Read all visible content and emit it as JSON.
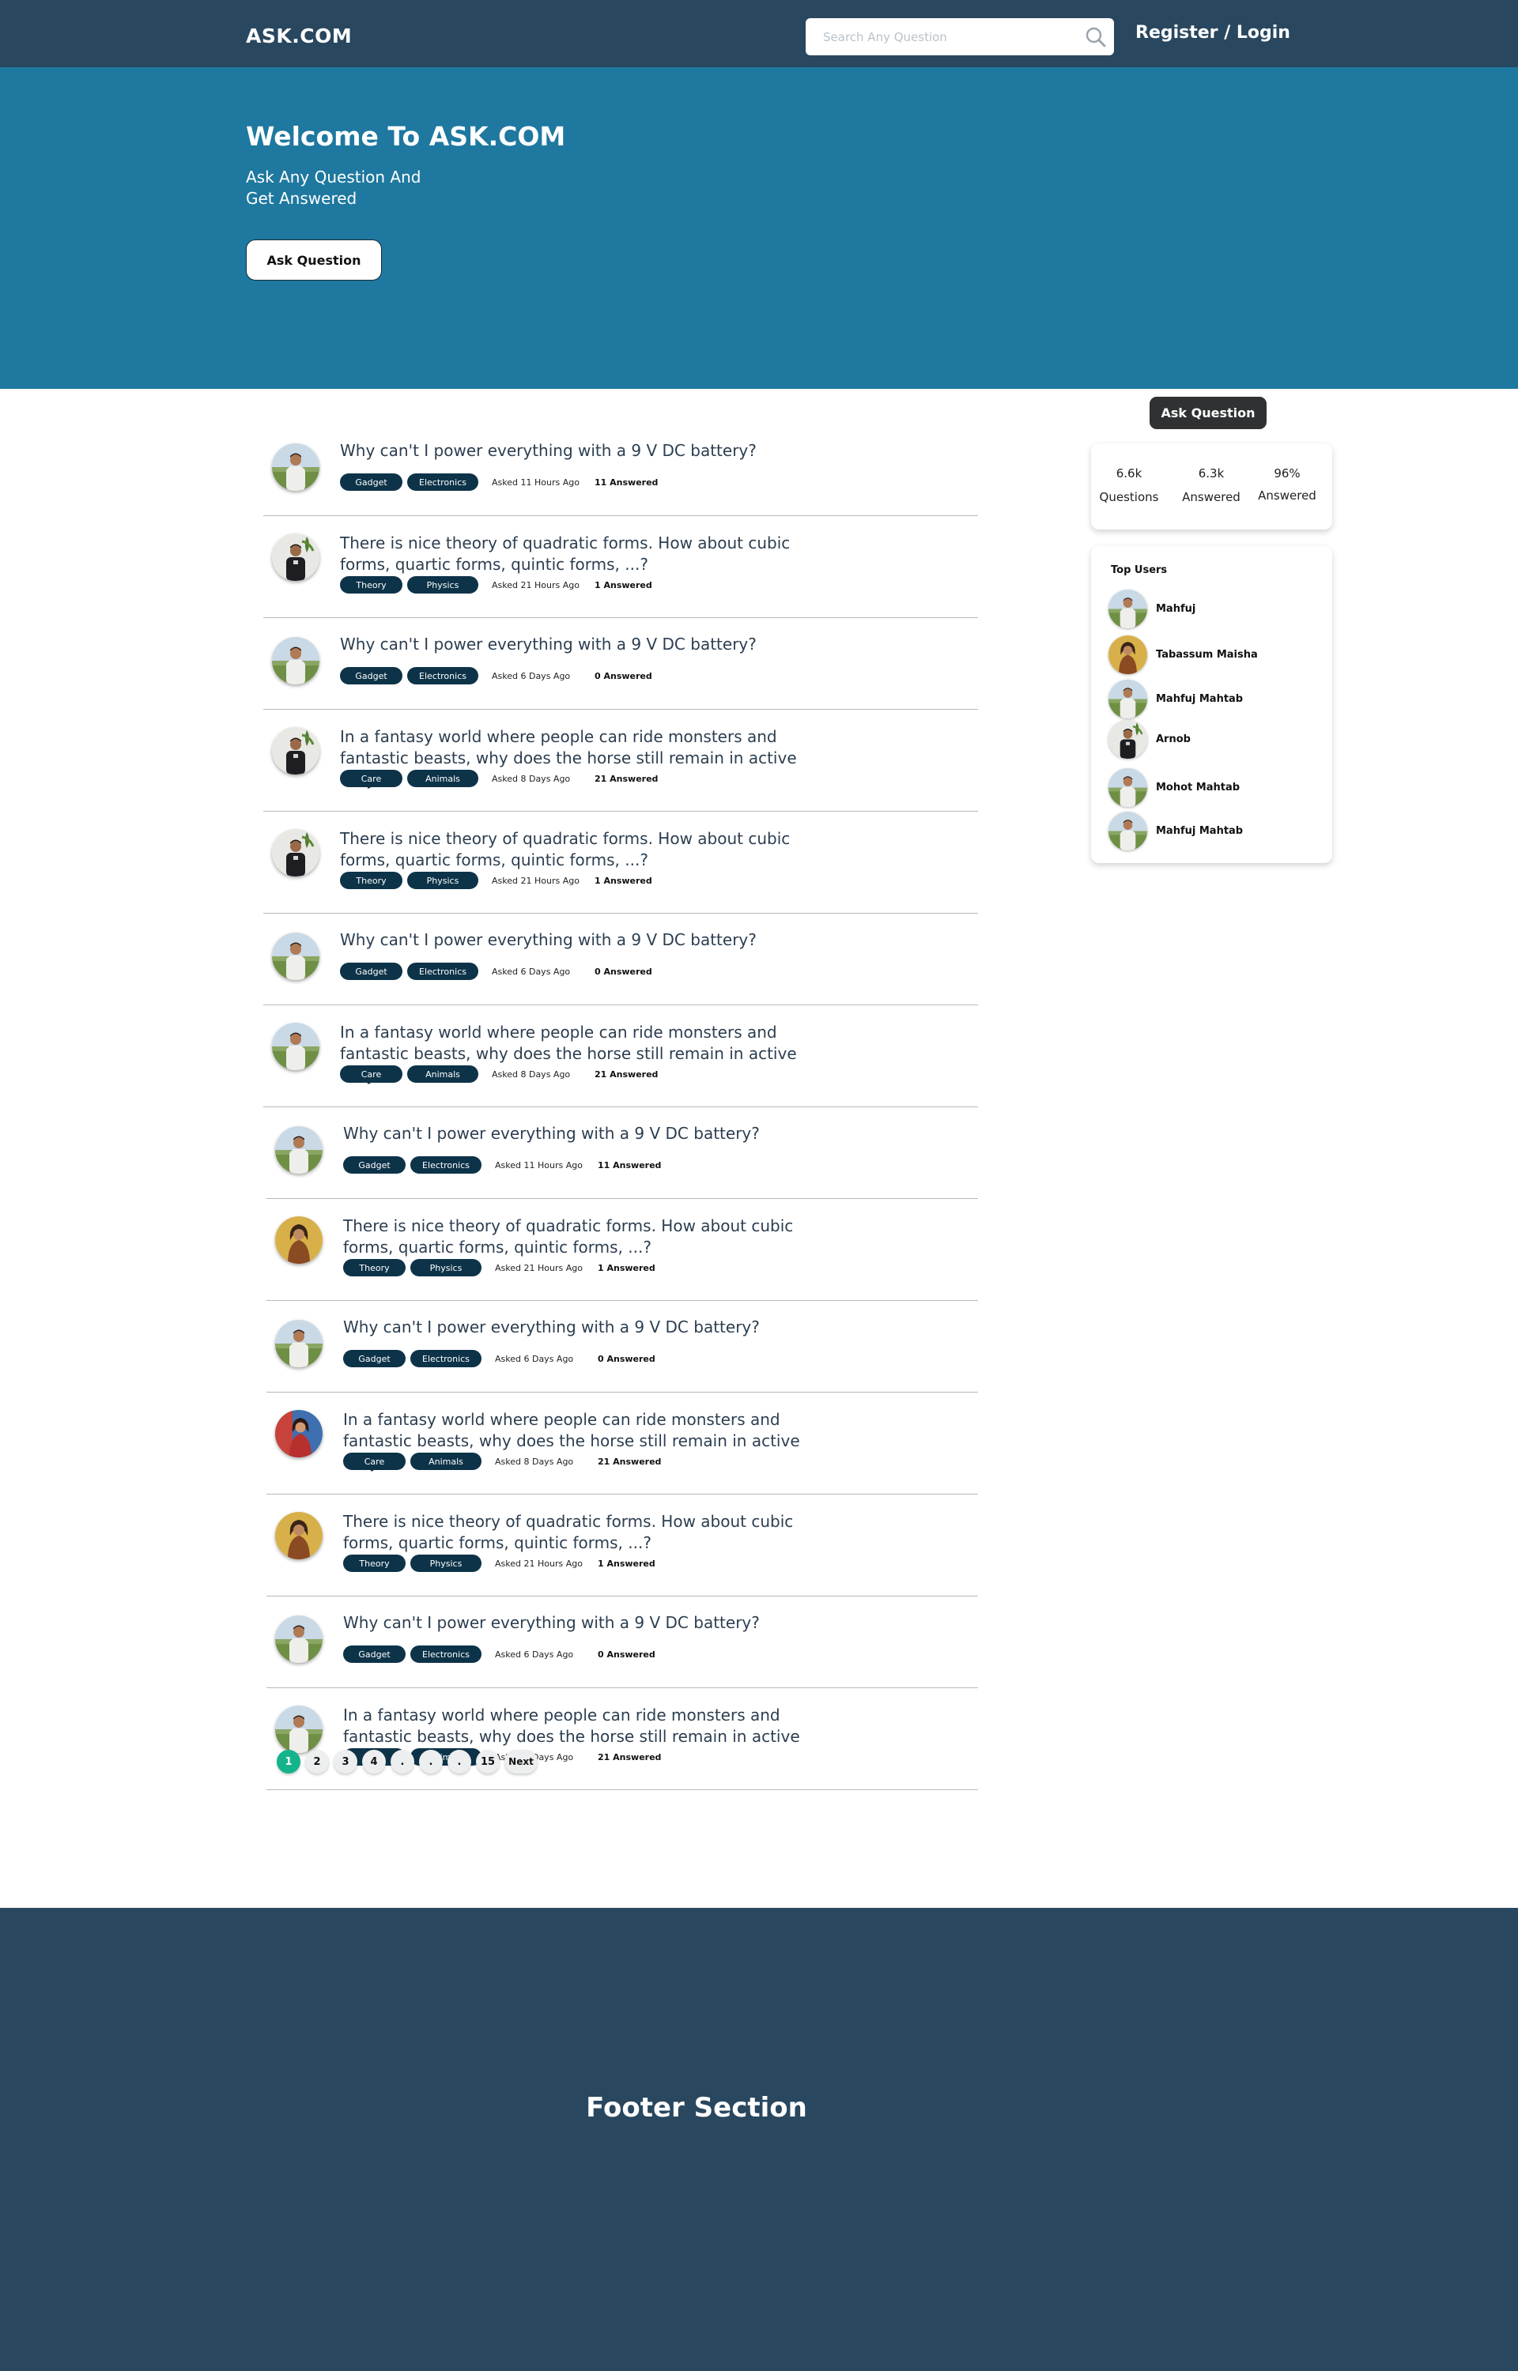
{
  "nav": {
    "logo": "ASK.COM",
    "search_placeholder": "Search Any Question",
    "auth_label": "Register / Login"
  },
  "hero": {
    "title": "Welcome To ASK.COM",
    "subtitle": "Ask Any Question And Get Answered",
    "button_label": "Ask Question"
  },
  "questions": [
    {
      "text": "Why can't I power everything with a 9 V DC battery?",
      "tags": [
        "Gadget",
        "Electronics"
      ],
      "asked": "Asked 11 Hours Ago",
      "answered": "11 Answered",
      "avatar": "man-white-shirt"
    },
    {
      "text": "There is nice theory of quadratic forms. How about cubic forms, quartic forms, quintic forms, ...?",
      "tags": [
        "Theory",
        "Physics"
      ],
      "asked": "Asked 21 Hours Ago",
      "answered": "1 Answered",
      "avatar": "man-dark-tshirt"
    },
    {
      "text": "Why can't I power everything with a 9 V DC battery?",
      "tags": [
        "Gadget",
        "Electronics"
      ],
      "asked": "Asked 6 Days Ago",
      "answered": "0 Answered",
      "avatar": "man-white-shirt"
    },
    {
      "text": "In a fantasy world where people can ride monsters and fantastic beasts, why does the horse still remain in active duty?",
      "tags": [
        "Care",
        "Animals"
      ],
      "asked": "Asked 8 Days Ago",
      "answered": "21 Answered",
      "avatar": "man-dark-tshirt"
    },
    {
      "text": "There is nice theory of quadratic forms. How about cubic forms, quartic forms, quintic forms, ...?",
      "tags": [
        "Theory",
        "Physics"
      ],
      "asked": "Asked 21 Hours Ago",
      "answered": "1 Answered",
      "avatar": "man-dark-tshirt"
    },
    {
      "text": "Why can't I power everything with a 9 V DC battery?",
      "tags": [
        "Gadget",
        "Electronics"
      ],
      "asked": "Asked 6 Days Ago",
      "answered": "0 Answered",
      "avatar": "man-white-shirt"
    },
    {
      "text": "In a fantasy world where people can ride monsters and fantastic beasts, why does the horse still remain in active duty?",
      "tags": [
        "Care",
        "Animals"
      ],
      "asked": "Asked 8 Days Ago",
      "answered": "21 Answered",
      "avatar": "man-white-shirt"
    },
    {
      "text": "Why can't I power everything with a 9 V DC battery?",
      "tags": [
        "Gadget",
        "Electronics"
      ],
      "asked": "Asked 11 Hours Ago",
      "answered": "11 Answered",
      "avatar": "man-white-shirt"
    },
    {
      "text": "There is nice theory of quadratic forms. How about cubic forms, quartic forms, quintic forms, ...?",
      "tags": [
        "Theory",
        "Physics"
      ],
      "asked": "Asked 21 Hours Ago",
      "answered": "1 Answered",
      "avatar": "woman-brown"
    },
    {
      "text": "Why can't I power everything with a 9 V DC battery?",
      "tags": [
        "Gadget",
        "Electronics"
      ],
      "asked": "Asked 6 Days Ago",
      "answered": "0 Answered",
      "avatar": "man-white-shirt"
    },
    {
      "text": "In a fantasy world where people can ride monsters and fantastic beasts, why does the horse still remain in active duty?",
      "tags": [
        "Care",
        "Animals"
      ],
      "asked": "Asked 8 Days Ago",
      "answered": "21 Answered",
      "avatar": "woman-red"
    },
    {
      "text": "There is nice theory of quadratic forms. How about cubic forms, quartic forms, quintic forms, ...?",
      "tags": [
        "Theory",
        "Physics"
      ],
      "asked": "Asked 21 Hours Ago",
      "answered": "1 Answered",
      "avatar": "woman-brown"
    },
    {
      "text": "Why can't I power everything with a 9 V DC battery?",
      "tags": [
        "Gadget",
        "Electronics"
      ],
      "asked": "Asked 6 Days Ago",
      "answered": "0 Answered",
      "avatar": "man-white-shirt"
    },
    {
      "text": "In a fantasy world where people can ride monsters and fantastic beasts, why does the horse still remain in active duty?",
      "tags": [
        "Care",
        "Animals"
      ],
      "asked": "Asked 8 Days Ago",
      "answered": "21 Answered",
      "avatar": "man-white-shirt"
    }
  ],
  "pagination": [
    "1",
    "2",
    "3",
    "4",
    ".",
    ".",
    ".",
    "15",
    "Next"
  ],
  "sidebar": {
    "ask_button": "Ask Question",
    "stats": [
      {
        "value": "6.6k",
        "label": "Questions"
      },
      {
        "value": "6.3k",
        "label": "Answered"
      },
      {
        "value": "96%",
        "label": "Answered"
      }
    ],
    "top_users_title": "Top Users",
    "top_users": [
      {
        "name": "Mahfuj",
        "avatar": "man-white-shirt"
      },
      {
        "name": "Tabassum Maisha",
        "avatar": "woman-brown"
      },
      {
        "name": "Mahfuj Mahtab",
        "avatar": "man-white-shirt"
      },
      {
        "name": "Arnob",
        "avatar": "man-dark-tshirt"
      },
      {
        "name": "Mohot Mahtab",
        "avatar": "man-white-shirt"
      },
      {
        "name": "Mahfuj Mahtab",
        "avatar": "man-white-shirt"
      }
    ]
  },
  "footer": {
    "title": "Footer Section"
  },
  "colors": {
    "nav": "#29475f",
    "hero": "#1e789f",
    "tag": "#0d3349",
    "active_page": "#14b38c",
    "footer": "#29475f"
  }
}
